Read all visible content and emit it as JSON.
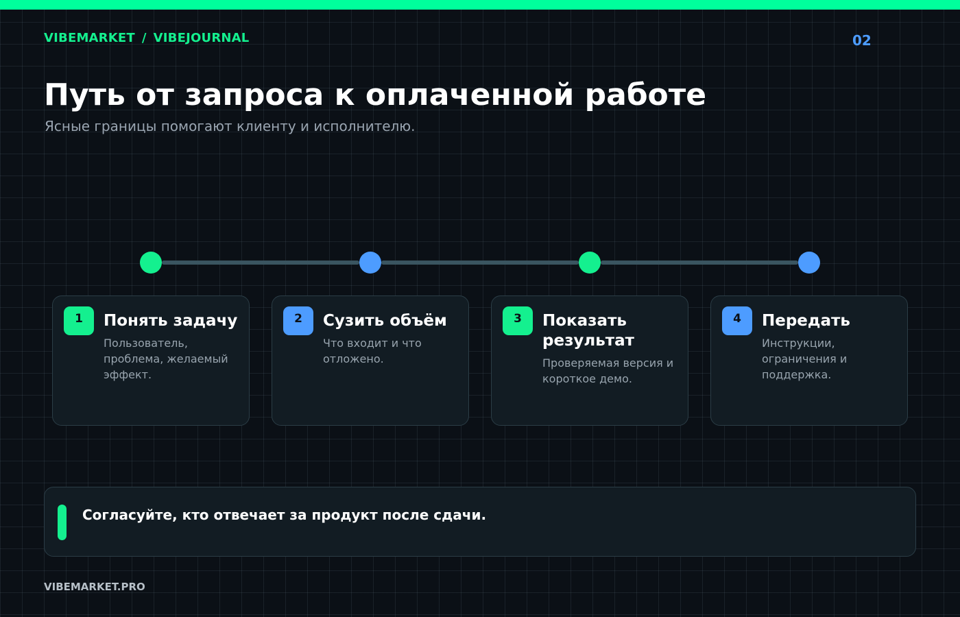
{
  "header": {
    "brand_primary": "VIBEMARKET",
    "brand_separator": "/",
    "brand_secondary": "VIBEJOURNAL",
    "page_number": "02"
  },
  "main": {
    "title": "Путь от запроса к оплаченной работе",
    "subtitle": "Ясные границы помогают клиенту и исполнителю."
  },
  "steps": [
    {
      "number": "1",
      "title": "Понять задачу",
      "description": "Пользователь, проблема, желаемый эффект.",
      "color": "green"
    },
    {
      "number": "2",
      "title": "Сузить объём",
      "description": "Что входит и что отложено.",
      "color": "blue"
    },
    {
      "number": "3",
      "title": "Показать результат",
      "description": "Проверяемая версия и короткое демо.",
      "color": "green"
    },
    {
      "number": "4",
      "title": "Передать",
      "description": "Инструкции, ограничения и поддержка.",
      "color": "blue"
    }
  ],
  "note": {
    "text": "Согласуйте, кто отвечает за продукт после сдачи."
  },
  "footer": {
    "site": "VIBEMARKET.PRO"
  },
  "colors": {
    "accent_green": "#14f08f",
    "accent_blue": "#4d9cff",
    "background": "#0b1016",
    "card": "#121c23"
  }
}
